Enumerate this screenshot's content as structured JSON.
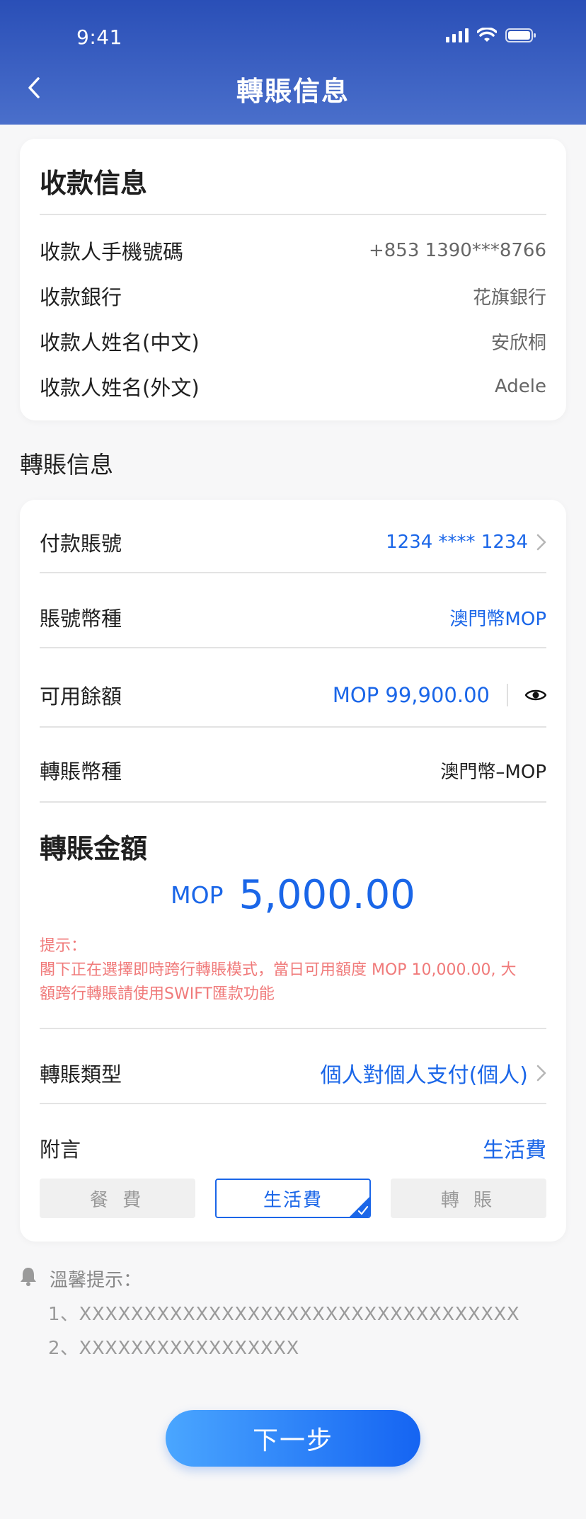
{
  "status_bar": {
    "time": "9:41"
  },
  "nav": {
    "title": "轉賬信息"
  },
  "payee": {
    "title": "收款信息",
    "rows": [
      {
        "label": "收款人手機號碼",
        "value": "+853 1390***8766"
      },
      {
        "label": "收款銀行",
        "value": "花旗銀行"
      },
      {
        "label": "收款人姓名(中文)",
        "value": "安欣桐"
      },
      {
        "label": "收款人姓名(外文)",
        "value": "Adele"
      }
    ]
  },
  "transfer": {
    "section_title": "轉賬信息",
    "pay_account": {
      "label": "付款賬號",
      "value": "1234 **** 1234"
    },
    "account_currency": {
      "label": "賬號幣種",
      "value": "澳門幣MOP"
    },
    "available_balance": {
      "label": "可用餘額",
      "value": "MOP 99,900.00"
    },
    "transfer_currency": {
      "label": "轉賬幣種",
      "value": "澳門幣–MOP"
    },
    "amount": {
      "label": "轉賬金額",
      "currency": "MOP",
      "value": "5,000.00"
    },
    "hint": {
      "title": "提示：",
      "line1": "閣下正在選擇即時跨行轉賬模式，當日可用額度 MOP 10,000.00, 大",
      "line2": "額跨行轉賬請使用SWIFT匯款功能"
    },
    "transfer_type": {
      "label": "轉賬類型",
      "value": "個人對個人支付(個人)"
    },
    "remark": {
      "label": "附言",
      "value": "生活費",
      "tags": [
        "餐 費",
        "生活費",
        "轉 賬"
      ],
      "selected_index": 1
    }
  },
  "tips": {
    "title": "溫馨提示：",
    "items": [
      "1、XXXXXXXXXXXXXXXXXXXXXXXXXXXXXXXXXX",
      "2、XXXXXXXXXXXXXXXXX"
    ]
  },
  "next_button": {
    "label": "下一步"
  },
  "colors": {
    "primary_blue": "#1a66e8",
    "header_top": "#2a4fb7",
    "hint_red": "#f07a7a"
  }
}
